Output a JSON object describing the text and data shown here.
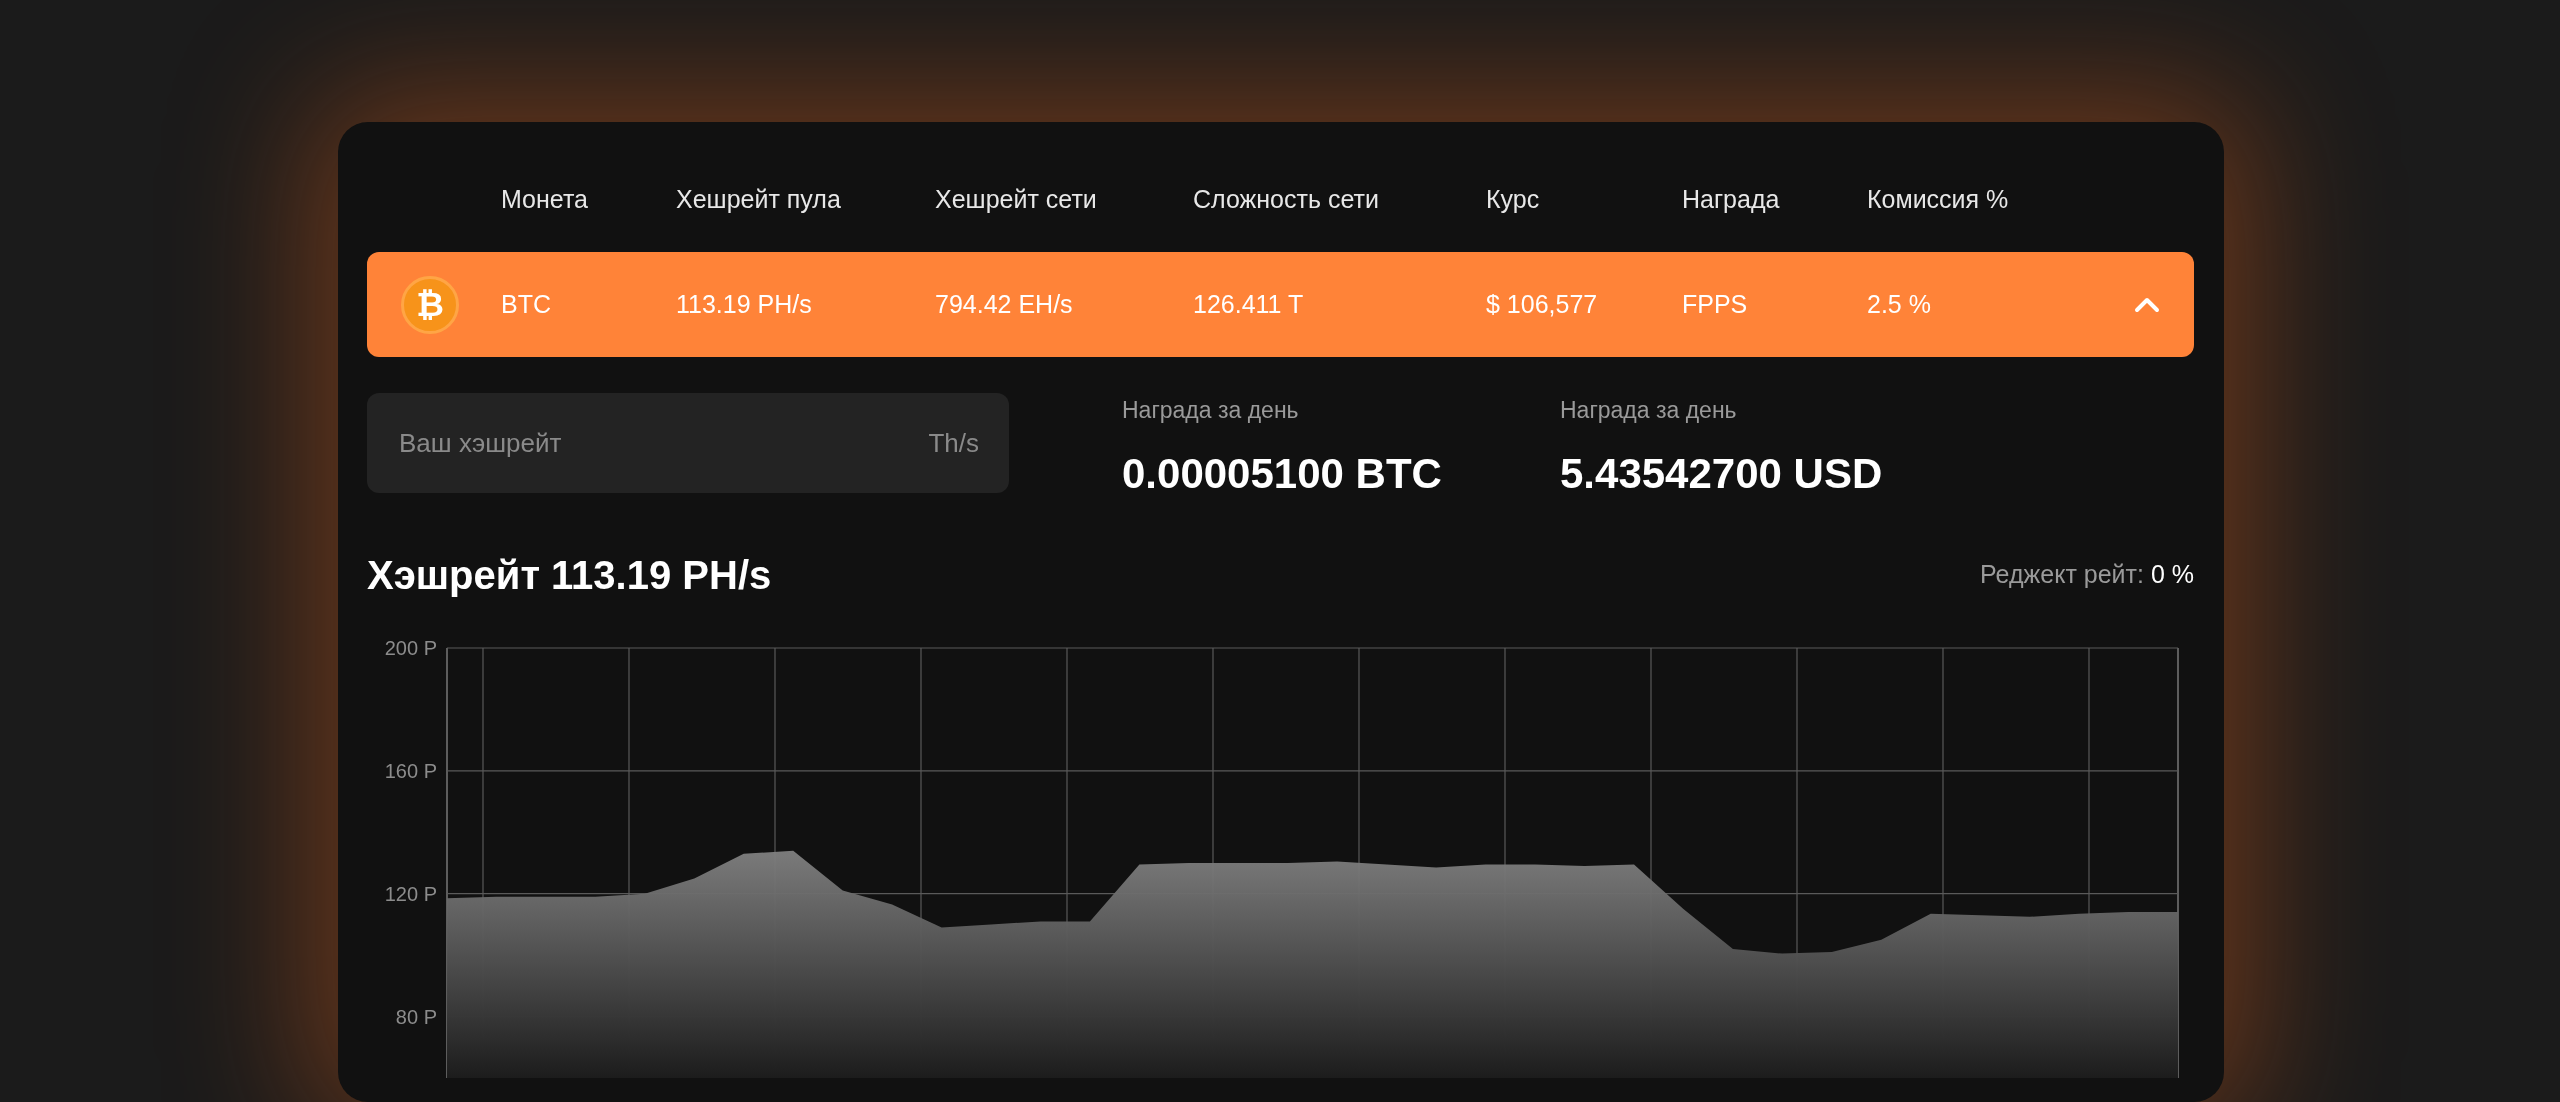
{
  "table": {
    "columns": [
      "Монета",
      "Хешрейт пула",
      "Хешрейт сети",
      "Сложность сети",
      "Курс",
      "Награда",
      "Комиссия %"
    ],
    "rows": [
      {
        "icon_glyph": "₿",
        "cells": [
          "BTC",
          "113.19 PH/s",
          "794.42 EH/s",
          "126.411 T",
          "$ 106,577",
          "FPPS",
          "2.5 %"
        ],
        "expanded": true
      }
    ]
  },
  "calculator": {
    "placeholder": "Ваш хэшрейт",
    "unit": "Th/s"
  },
  "rewards": [
    {
      "label": "Награда за день",
      "value": "0.00005100 BTC"
    },
    {
      "label": "Награда за день",
      "value": "5.43542700 USD"
    }
  ],
  "hashrate": {
    "title": "Хэшрейт 113.19 PH/s",
    "reject_label": "Реджект рейт:",
    "reject_value": "0 %",
    "chart_data": {
      "type": "area",
      "ylim": [
        60,
        200
      ],
      "categories": [
        null,
        null,
        null,
        null,
        null,
        null,
        null,
        null,
        null,
        null,
        null,
        null,
        null,
        null,
        null,
        null,
        null,
        null,
        null,
        null,
        null,
        null,
        null,
        null,
        null,
        null,
        null,
        null,
        null,
        null,
        null,
        null,
        null,
        null,
        null,
        null
      ],
      "yticks": [
        {
          "value": 80,
          "label": "80 P"
        },
        {
          "value": 120,
          "label": "120 P"
        },
        {
          "value": 160,
          "label": "160 P"
        },
        {
          "value": 200,
          "label": "200 P"
        }
      ],
      "series": [
        {
          "color": "#808080",
          "values": [
            118.5,
            119,
            119,
            119,
            120,
            125,
            133,
            134,
            121,
            116.5,
            109,
            110,
            111,
            111,
            129.5,
            130,
            130,
            130,
            130.5,
            129.5,
            128.5,
            129.5,
            129.5,
            129,
            129.5,
            115,
            102,
            100.5,
            101,
            105,
            113.5,
            113,
            112.5,
            113.5,
            114,
            114
          ]
        }
      ]
    }
  }
}
